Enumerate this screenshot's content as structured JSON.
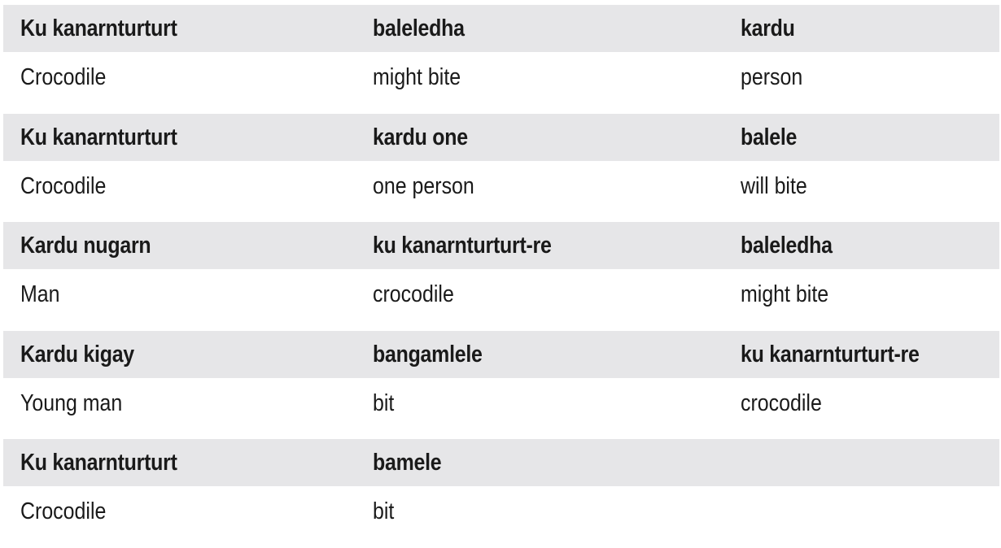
{
  "rows": [
    {
      "header": [
        "Ku kanarnturturt",
        "baleledha",
        "kardu"
      ],
      "gloss": [
        "Crocodile",
        "might bite",
        "person"
      ]
    },
    {
      "header": [
        "Ku kanarnturturt",
        "kardu one",
        "balele"
      ],
      "gloss": [
        "Crocodile",
        "one person",
        "will bite"
      ]
    },
    {
      "header": [
        "Kardu nugarn",
        "ku kanarnturturt-re",
        "baleledha"
      ],
      "gloss": [
        "Man",
        "crocodile",
        "might bite"
      ]
    },
    {
      "header": [
        "Kardu kigay",
        "bangamlele",
        "ku kanarnturturt-re"
      ],
      "gloss": [
        "Young man",
        "bit",
        "crocodile"
      ]
    },
    {
      "header": [
        "Ku kanarnturturt",
        "bamele",
        ""
      ],
      "gloss": [
        "Crocodile",
        "bit",
        ""
      ]
    }
  ],
  "colors": {
    "header_band": "#e6e6e8",
    "text": "#1a1a1a",
    "background": "#ffffff"
  }
}
